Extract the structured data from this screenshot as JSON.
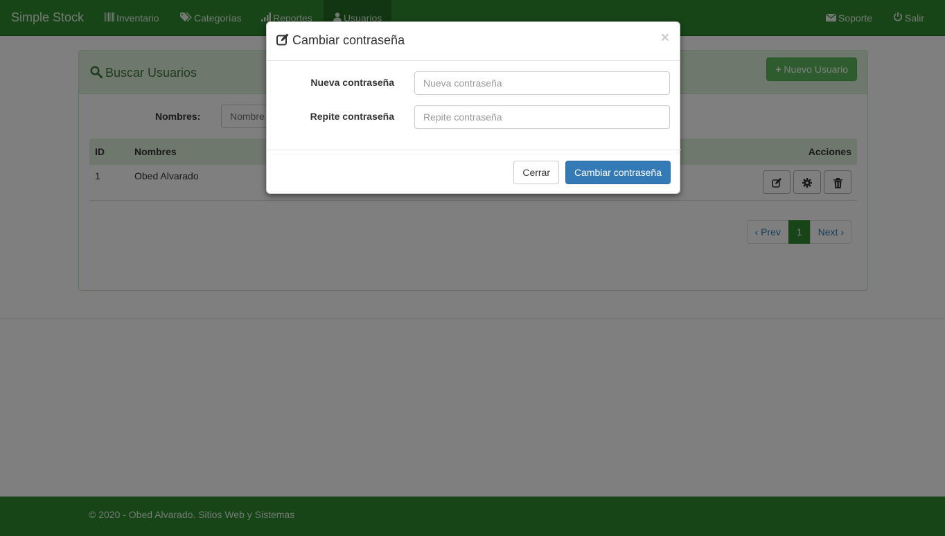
{
  "navbar": {
    "brand": "Simple Stock",
    "items": [
      {
        "label": "Inventario",
        "icon": "barcode-icon"
      },
      {
        "label": "Categorías",
        "icon": "tags-icon"
      },
      {
        "label": "Reportes",
        "icon": "signal-icon"
      },
      {
        "label": "Usuarios",
        "icon": "user-icon",
        "active": true
      }
    ],
    "right_items": [
      {
        "label": "Soporte",
        "icon": "envelope-icon"
      },
      {
        "label": "Salir",
        "icon": "power-icon"
      }
    ]
  },
  "panel": {
    "title": "Buscar Usuarios",
    "new_button": "Nuevo Usuario",
    "search_label": "Nombres:",
    "search_placeholder": "Nombre"
  },
  "table": {
    "headers": [
      "ID",
      "Nombres",
      "Acciones"
    ],
    "rows": [
      {
        "id": "1",
        "name": "Obed Alvarado"
      }
    ]
  },
  "pagination": {
    "prev": "‹ Prev",
    "current": "1",
    "next": "Next ›"
  },
  "footer": {
    "text": "© 2020 - Obed Alvarado. Sitios Web y Sistemas"
  },
  "modal": {
    "title": "Cambiar contraseña",
    "close": "×",
    "fields": [
      {
        "label": "Nueva contraseña",
        "placeholder": "Nueva contraseña"
      },
      {
        "label": "Repite contraseña",
        "placeholder": "Repite contraseña"
      }
    ],
    "cancel_button": "Cerrar",
    "submit_button": "Cambiar contraseña"
  },
  "colors": {
    "navbar": "#2f8a30",
    "primary": "#337ab7",
    "success": "#5cb85c",
    "panel_heading": "#dff0d8"
  }
}
